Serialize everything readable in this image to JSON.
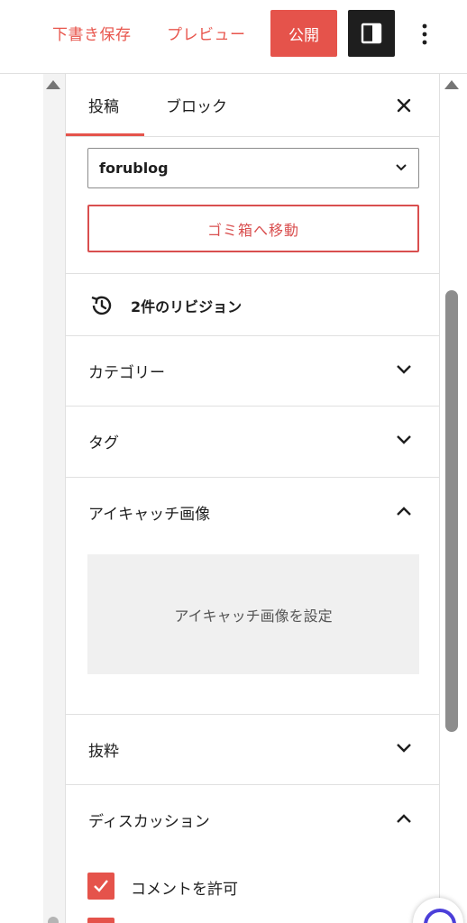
{
  "toolbar": {
    "save_draft_label": "下書き保存",
    "preview_label": "プレビュー",
    "publish_label": "公開",
    "panel_icon": "sidebar-toggle-icon",
    "more_icon": "more-vertical-icon"
  },
  "tabs": {
    "post_label": "投稿",
    "block_label": "ブロック",
    "close_icon": "close-icon"
  },
  "author": {
    "selected": "forublog"
  },
  "trash_label": "ゴミ箱へ移動",
  "revisions_label": "2件のリビジョン",
  "sections": {
    "categories": "カテゴリー",
    "tags": "タグ",
    "featured_image": "アイキャッチ画像",
    "featured_image_button": "アイキャッチ画像を設定",
    "excerpt": "抜粋",
    "discussion": "ディスカッション"
  },
  "discussion": {
    "allow_comments": "コメントを許可",
    "allow_comments_checked": true
  },
  "colors": {
    "accent": "#e5534b",
    "dark": "#1e1e1e"
  }
}
